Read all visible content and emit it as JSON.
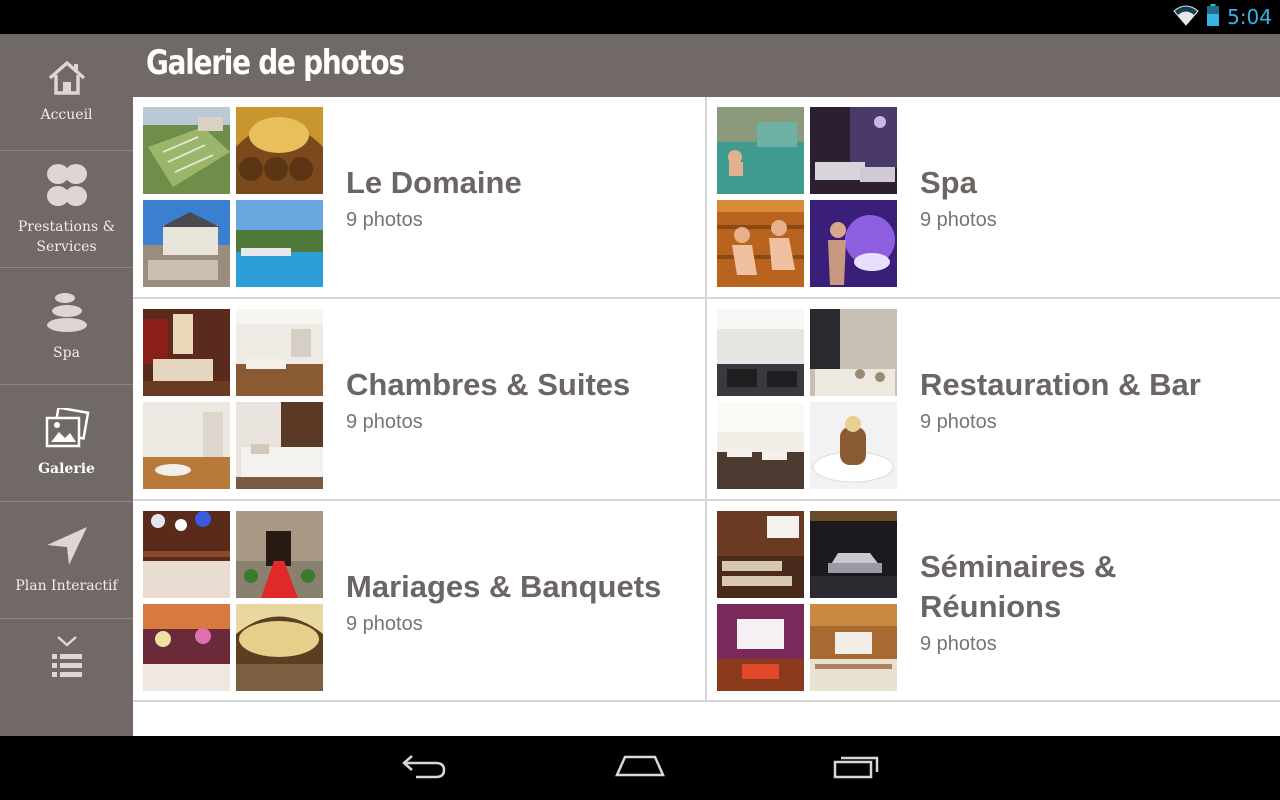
{
  "status": {
    "time": "5:04"
  },
  "header": {
    "title": "Galerie de photos"
  },
  "sidebar": {
    "items": [
      {
        "label": "Accueil",
        "icon": "home-icon"
      },
      {
        "label": "Prestations & Services",
        "icon": "clover-icon"
      },
      {
        "label": "Spa",
        "icon": "stones-icon"
      },
      {
        "label": "Galerie",
        "icon": "photos-icon",
        "active": true
      },
      {
        "label": "Plan Interactif",
        "icon": "navigation-arrow-icon"
      },
      {
        "label": "",
        "icon": "more-menu-icon"
      }
    ]
  },
  "gallery": {
    "albums": [
      {
        "title": "Le Domaine",
        "count": "9 photos"
      },
      {
        "title": "Spa",
        "count": "9 photos"
      },
      {
        "title": "Chambres & Suites",
        "count": "9 photos"
      },
      {
        "title": "Restauration & Bar",
        "count": "9 photos"
      },
      {
        "title": "Mariages & Banquets",
        "count": "9 photos"
      },
      {
        "title": "Séminaires & Réunions",
        "count": "9 photos"
      }
    ]
  },
  "navbar": {
    "icons": [
      "back-icon",
      "home-icon",
      "recent-apps-icon"
    ]
  },
  "colors": {
    "sidebar": "#706966",
    "accent": "#33b5e5",
    "card_title": "#6b6563"
  }
}
